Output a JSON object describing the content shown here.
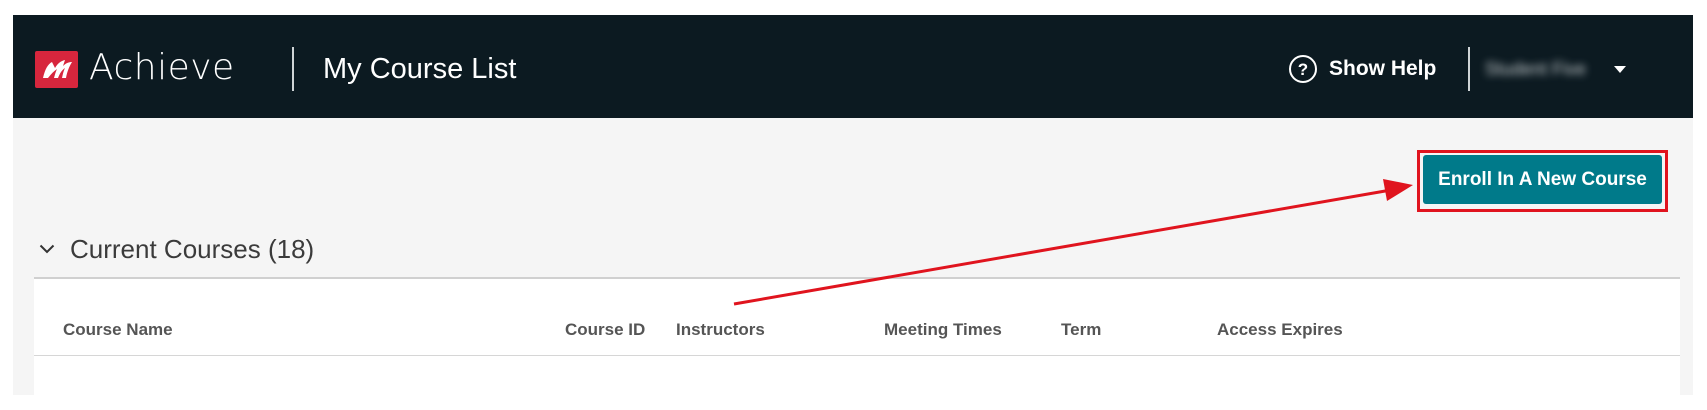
{
  "header": {
    "brand": "Achieve",
    "page_title": "My Course List",
    "help_icon": "question-circle-icon",
    "help_label": "Show Help",
    "user_name": "Student Five",
    "caret_icon": "caret-down-icon"
  },
  "actions": {
    "enroll_label": "Enroll In A New Course"
  },
  "section": {
    "chevron_icon": "chevron-down-icon",
    "title": "Current Courses (18)"
  },
  "table": {
    "columns": [
      "Course Name",
      "Course ID",
      "Instructors",
      "Meeting Times",
      "Term",
      "Access Expires"
    ]
  },
  "colors": {
    "header_bg": "#0c1a21",
    "brand_red": "#d7263d",
    "enroll_button": "#007a8a",
    "annotation_red": "#e0141e"
  }
}
